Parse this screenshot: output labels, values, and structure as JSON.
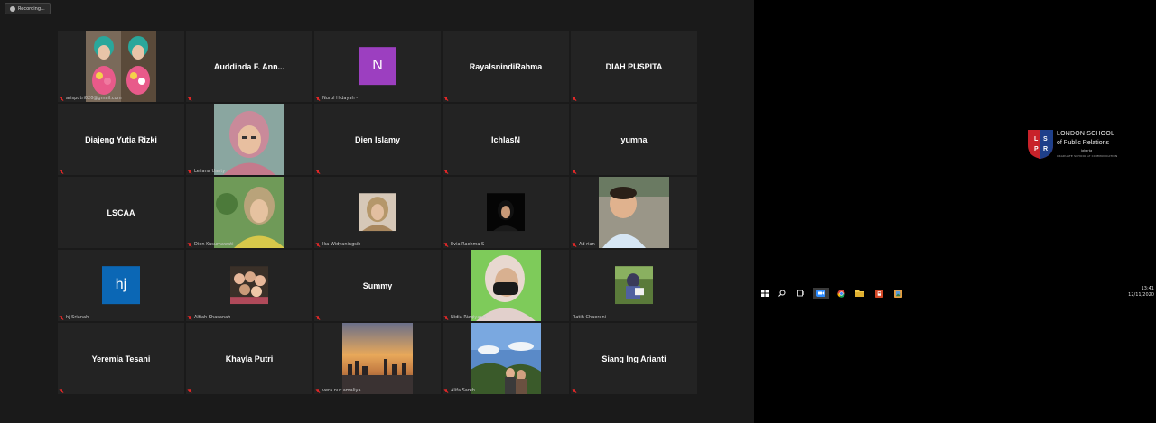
{
  "recording": {
    "label": "Recording..."
  },
  "tiles": [
    {
      "footer": "arisputri020@gmail.com",
      "center": ""
    },
    {
      "footer": "",
      "center": "Auddinda  F.  Ann..."
    },
    {
      "footer": "Nurul Hidayah -",
      "center": "",
      "avatar_letter": "N"
    },
    {
      "footer": "",
      "center": "RayaIsnindiRahma"
    },
    {
      "footer": "",
      "center": "DIAH PUSPITA"
    },
    {
      "footer": "",
      "center": "Diajeng Yutia Rizki"
    },
    {
      "footer": "Leliana Uanty",
      "center": ""
    },
    {
      "footer": "",
      "center": "Dien Islamy"
    },
    {
      "footer": "",
      "center": "IchlasN"
    },
    {
      "footer": "",
      "center": "yumna"
    },
    {
      "footer": "",
      "center": "LSCAA"
    },
    {
      "footer": "Dien Kusumawati",
      "center": ""
    },
    {
      "footer": "Ika Widyaningsih",
      "center": ""
    },
    {
      "footer": "Evia Rachma S",
      "center": ""
    },
    {
      "footer": "Ad rian",
      "center": ""
    },
    {
      "footer": "hj Srianah",
      "center": "",
      "avatar_letter": "hj"
    },
    {
      "footer": "Alfiah Khasanah",
      "center": ""
    },
    {
      "footer": "",
      "center": "Summy"
    },
    {
      "footer": "Nidia Rizqiyanti",
      "center": ""
    },
    {
      "footer": "Ratih Chaerani",
      "center": ""
    },
    {
      "footer": "",
      "center": "Yeremia Tesani"
    },
    {
      "footer": "",
      "center": "Khayla Putri"
    },
    {
      "footer": "vera nur amaliya",
      "center": ""
    },
    {
      "footer": "Alifa Sareh",
      "center": ""
    },
    {
      "footer": "",
      "center": "Siang Ing Arianti"
    }
  ],
  "logo": {
    "line1": "LONDON SCHOOL",
    "line2": "of Public Relations",
    "line3": "Jakarta",
    "line4": "GRADUATE SCHOOL of COMMUNICATION",
    "shield_letters": [
      "L",
      "S",
      "P",
      "R"
    ]
  },
  "taskbar": {
    "clock_time": "13:41",
    "clock_date": "12/11/2020"
  },
  "colors": {
    "avatar_n": "#9c3fc0",
    "avatar_hj": "#0b67b5",
    "muted_mic": "#e02828"
  }
}
